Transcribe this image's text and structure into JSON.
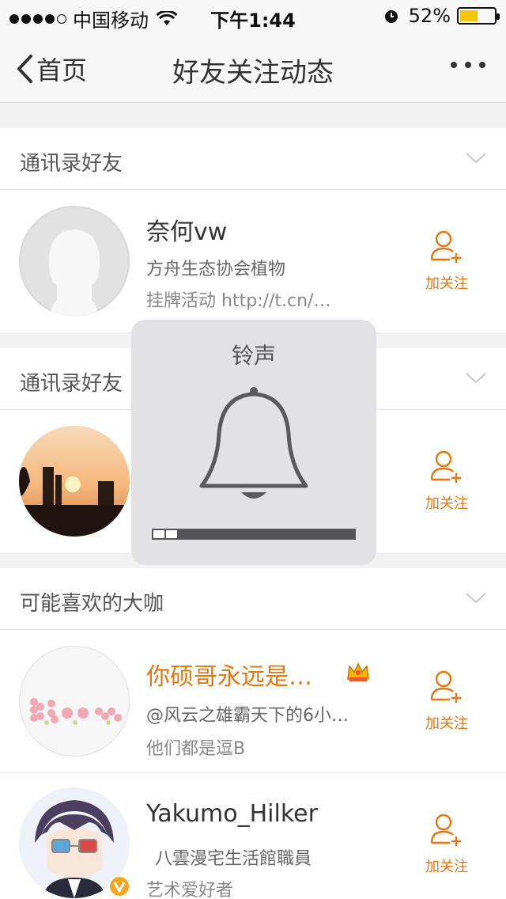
{
  "status_bar": {
    "carrier": "中国移动",
    "time": "下午1:44",
    "battery": "52%",
    "battery_level": 0.52
  },
  "nav": {
    "back_label": "首页",
    "title": "好友关注动态"
  },
  "sections": [
    {
      "title": "通讯录好友",
      "users": [
        {
          "name": "奈何vw",
          "line1": "方舟生态协会植物",
          "line2": "挂牌活动 http://t.cn/…",
          "follow_label": "加关注"
        }
      ]
    },
    {
      "title": "通讯录好友",
      "users": [
        {
          "follow_label": "加关注"
        }
      ]
    },
    {
      "title": "可能喜欢的大咖",
      "users": [
        {
          "name": "你硕哥永远是…",
          "line1": "@风云之雄霸天下的6小…",
          "line2": "他们都是逗B",
          "follow_label": "加关注"
        },
        {
          "name": "Yakumo_Hilker",
          "line1": "八雲漫宅生活館職員",
          "line2": "艺术爱好者",
          "follow_label": "加关注"
        }
      ]
    }
  ],
  "volume_hud": {
    "title": "铃声",
    "level": 0.1
  },
  "colors": {
    "accent_orange": "#e8750d",
    "verified_badge": "#f5a623"
  }
}
